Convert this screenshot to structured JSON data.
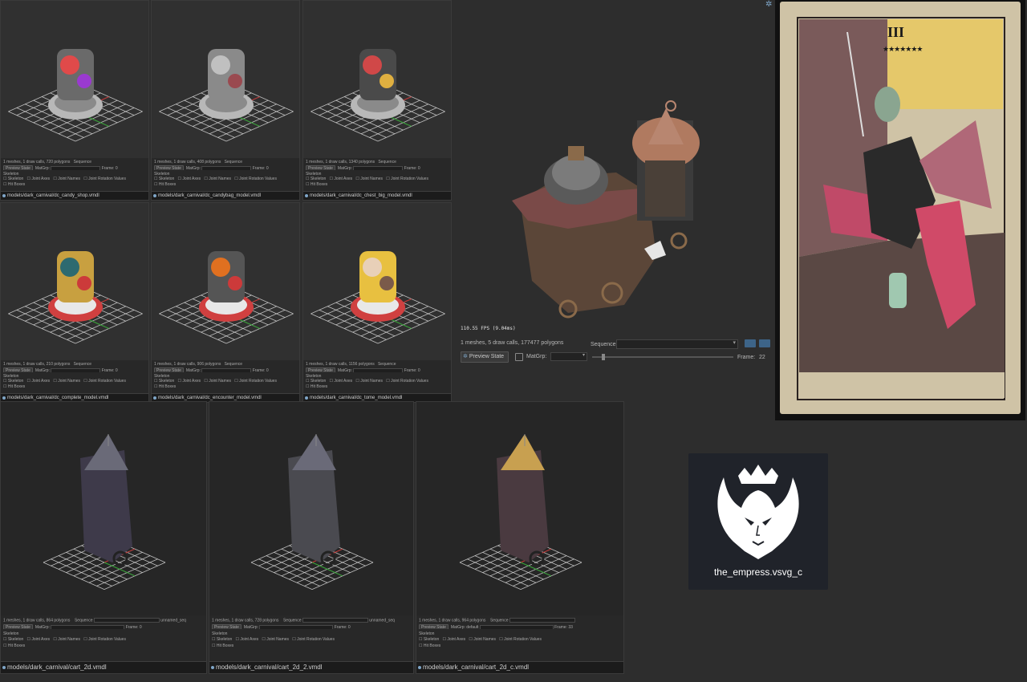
{
  "small_panels": [
    {
      "path": "models/dark_carnival/dc_candy_shop.vmdl",
      "stats": "1 meshes, 1 draw calls, 720 polygons",
      "preview": "Preview State",
      "matgrp": "MatGrp:",
      "sequence_label": "Sequence",
      "frame_label": "Frame:",
      "frame": "0"
    },
    {
      "path": "models/dark_carnival/dc_candybag_model.vmdl",
      "stats": "1 meshes, 1 draw calls, 408 polygons",
      "preview": "Preview State",
      "matgrp": "MatGrp:",
      "sequence_label": "Sequence",
      "frame_label": "Frame:",
      "frame": "0"
    },
    {
      "path": "models/dark_carnival/dc_chest_big_model.vmdl",
      "stats": "1 meshes, 1 draw calls, 1340 polygons",
      "preview": "Preview State",
      "matgrp": "MatGrp:",
      "sequence_label": "Sequence",
      "frame_label": "Frame:",
      "frame": "0"
    },
    {
      "path": "models/dark_carnival/dc_complete_model.vmdl",
      "stats": "1 meshes, 1 draw calls, 210 polygons",
      "preview": "Preview State",
      "matgrp": "MatGrp:",
      "sequence_label": "Sequence",
      "frame_label": "Frame:",
      "frame": "0"
    },
    {
      "path": "models/dark_carnival/dc_encounter_model.vmdl",
      "stats": "1 meshes, 1 draw calls, 906 polygons",
      "preview": "Preview State",
      "matgrp": "MatGrp:",
      "sequence_label": "Sequence",
      "frame_label": "Frame:",
      "frame": "0"
    },
    {
      "path": "models/dark_carnival/dc_tome_model.vmdl",
      "stats": "1 meshes, 1 draw calls, 1156 polygons",
      "preview": "Preview State",
      "matgrp": "MatGrp:",
      "sequence_label": "Sequence",
      "frame_label": "Frame:",
      "frame": "0"
    }
  ],
  "checkbox_labels": [
    "Skeleton",
    "Joint Axes",
    "Joint Names",
    "Joint Rotation Values",
    "Hit Boxes"
  ],
  "main_viewer": {
    "fps": "110.55 FPS (9.04ms)",
    "stats": "1 meshes, 5 draw calls, 177477 polygons",
    "sequence_label": "Sequence",
    "preview_button": "Preview State",
    "matgrp_label": "MatGrp:",
    "frame_label": "Frame:",
    "frame_value": "22"
  },
  "cart_panels": [
    {
      "path": "models/dark_carnival/cart_2d.vmdl",
      "stats": "1 meshes, 1 draw calls, 864 polygons",
      "sequence_label": "Sequence",
      "sequence_value": "unnamed_seq",
      "preview": "Preview State",
      "matgrp": "MatGrp:",
      "frame_label": "Frame:",
      "frame": "0",
      "skeleton_label": "Skeleton"
    },
    {
      "path": "models/dark_carnival/cart_2d_2.vmdl",
      "stats": "1 meshes, 1 draw calls, 728 polygons",
      "sequence_label": "Sequence",
      "sequence_value": "unnamed_seq",
      "preview": "Preview State",
      "matgrp": "MatGrp:",
      "frame_label": "Frame:",
      "frame": "0",
      "skeleton_label": "Skeleton"
    },
    {
      "path": "models/dark_carnival/cart_2d_c.vmdl",
      "stats": "1 meshes, 1 draw calls, 964 polygons",
      "sequence_label": "Sequence",
      "sequence_value": "",
      "preview": "Preview State",
      "matgrp": "MatGrp:",
      "matgrp_value": "default",
      "frame_label": "Frame:",
      "frame": "33",
      "skeleton_label": "Skeleton"
    }
  ],
  "tarot": {
    "numeral": "III"
  },
  "empress_file": {
    "label": "the_empress.vsvg_c",
    "icon": "empress-icon"
  },
  "colors": {
    "accent": "#7fa6c8",
    "panel_bg": "#262626",
    "viewport_bg": "#303030",
    "grid": "#d8d8d8"
  }
}
